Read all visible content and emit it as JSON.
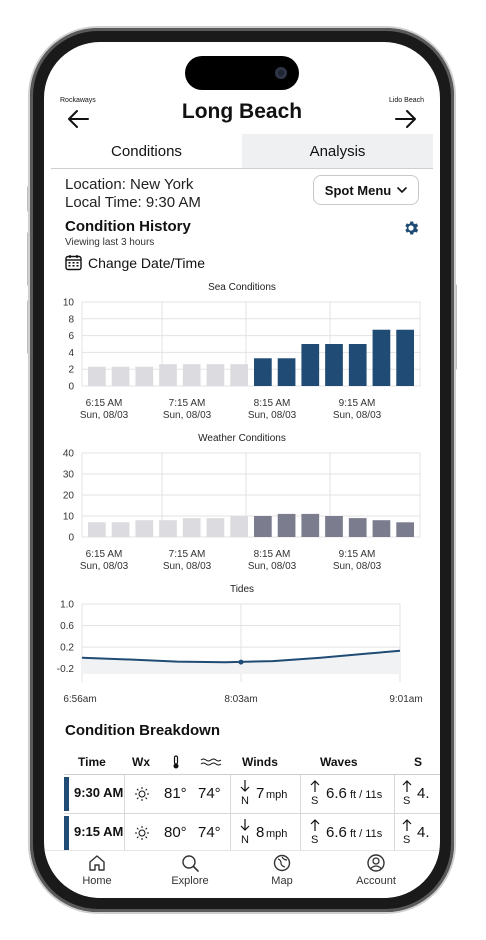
{
  "header": {
    "title": "Long Beach",
    "prev_spot": "Rockaways",
    "next_spot": "Lido Beach"
  },
  "tabs": [
    {
      "label": "Conditions",
      "active": true
    },
    {
      "label": "Analysis",
      "active": false
    }
  ],
  "location": {
    "location_text": "Location: New York",
    "time_text": "Local Time: 9:30 AM",
    "spot_menu_label": "Spot Menu"
  },
  "history": {
    "title": "Condition History",
    "subtitle": "Viewing last 3 hours",
    "change_label": "Change Date/Time"
  },
  "chart_data": [
    {
      "type": "bar",
      "title": "Sea Conditions",
      "ylim": [
        0,
        10
      ],
      "yticks": [
        "10",
        "8",
        "6",
        "4",
        "2",
        "0"
      ],
      "xticks": [
        {
          "time": "6:15 AM",
          "date": "Sun, 08/03"
        },
        {
          "time": "7:15 AM",
          "date": "Sun, 08/03"
        },
        {
          "time": "8:15 AM",
          "date": "Sun, 08/03"
        },
        {
          "time": "9:15 AM",
          "date": "Sun, 08/03"
        }
      ],
      "values": [
        2.3,
        2.3,
        2.3,
        2.6,
        2.6,
        2.6,
        2.6,
        3.3,
        3.3,
        5.0,
        5.0,
        5.0,
        6.7,
        6.7
      ],
      "colors": [
        "#dcdce0",
        "#dcdce0",
        "#dcdce0",
        "#dcdce0",
        "#dcdce0",
        "#dcdce0",
        "#dcdce0",
        "#1f4b74",
        "#1f4b74",
        "#1f4b74",
        "#1f4b74",
        "#1f4b74",
        "#1f4b74",
        "#1f4b74"
      ],
      "grid": true
    },
    {
      "type": "bar",
      "title": "Weather Conditions",
      "ylim": [
        0,
        40
      ],
      "yticks": [
        "40",
        "30",
        "20",
        "10",
        "0"
      ],
      "xticks": [
        {
          "time": "6:15 AM",
          "date": "Sun, 08/03"
        },
        {
          "time": "7:15 AM",
          "date": "Sun, 08/03"
        },
        {
          "time": "8:15 AM",
          "date": "Sun, 08/03"
        },
        {
          "time": "9:15 AM",
          "date": "Sun, 08/03"
        }
      ],
      "values": [
        7,
        7,
        8,
        8,
        9,
        9,
        10,
        10,
        11,
        11,
        10,
        9,
        8,
        7
      ],
      "colors": [
        "#dcdce0",
        "#dcdce0",
        "#dcdce0",
        "#dcdce0",
        "#dcdce0",
        "#dcdce0",
        "#dcdce0",
        "#7b7d8e",
        "#7b7d8e",
        "#7b7d8e",
        "#7b7d8e",
        "#7b7d8e",
        "#7b7d8e",
        "#7b7d8e"
      ],
      "grid": true
    },
    {
      "type": "area",
      "title": "Tides",
      "yticks": [
        "1.0",
        "0.6",
        "0.2",
        "-0.2"
      ],
      "ylim": [
        -0.3,
        1.0
      ],
      "xticks": [
        "6:56am",
        "8:03am",
        "9:01am"
      ],
      "x": [
        0,
        0.15,
        0.3,
        0.45,
        0.6,
        0.75,
        0.9,
        1.0
      ],
      "y": [
        0.0,
        -0.03,
        -0.07,
        -0.08,
        -0.06,
        0.0,
        0.08,
        0.13
      ],
      "marker_index": 3,
      "color": "#1f4b74"
    }
  ],
  "breakdown": {
    "title": "Condition Breakdown",
    "headers": [
      "Time",
      "Wx",
      "Winds",
      "Waves",
      "S"
    ],
    "rows": [
      {
        "time": "9:30 AM",
        "air": "81°",
        "water": "74°",
        "wind_dir": "N",
        "wind_speed": "7",
        "wind_unit": "mph",
        "wave_dir": "S",
        "wave_height": "6.6",
        "wave_unit": "ft / 11s",
        "swell_dir": "S",
        "swell_partial": "4."
      },
      {
        "time": "9:15 AM",
        "air": "80°",
        "water": "74°",
        "wind_dir": "N",
        "wind_speed": "8",
        "wind_unit": "mph",
        "wave_dir": "S",
        "wave_height": "6.6",
        "wave_unit": "ft / 11s",
        "swell_dir": "S",
        "swell_partial": "4."
      }
    ]
  },
  "nav": [
    {
      "label": "Home",
      "icon": "home-icon"
    },
    {
      "label": "Explore",
      "icon": "search-icon"
    },
    {
      "label": "Map",
      "icon": "map-icon"
    },
    {
      "label": "Account",
      "icon": "account-icon"
    }
  ]
}
